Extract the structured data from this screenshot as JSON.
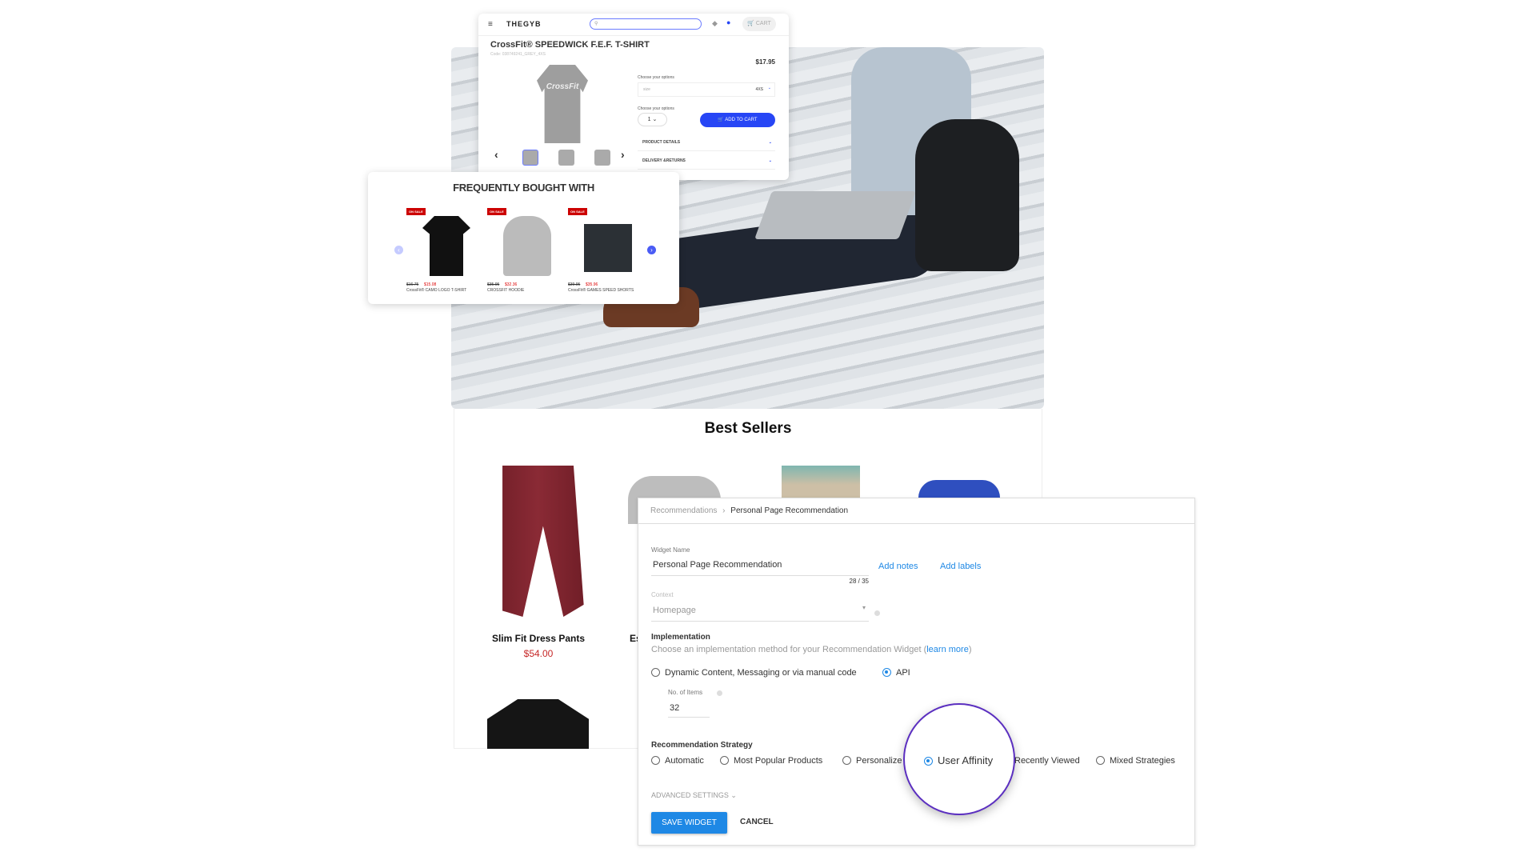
{
  "product_page": {
    "logo": "THEGYB",
    "cart_label": "CART",
    "title": "CrossFit® SPEEDWICK F.E.F. T-SHIRT",
    "code": "Code: 038749241_GREY_4XS",
    "price": "$17.95",
    "shirt_print": "CrossFit",
    "options_label_1": "Choose your options",
    "size_placeholder": "size",
    "size_value": "4XS",
    "options_label_2": "Choose your options",
    "quantity": "1",
    "add_to_cart": "ADD TO CART",
    "product_details": "PRODUCT DETAILS",
    "delivery_returns": "DELIVERY &RETURNS"
  },
  "frequently_bought": {
    "title": "FREQUENTLY BOUGHT WITH",
    "items": [
      {
        "badge": "ON SALE",
        "old_price": "$16.75",
        "price": "$15.08",
        "name": "CrossFit® CAMO LOGO T-SHIRT"
      },
      {
        "badge": "ON SALE",
        "old_price": "$35.95",
        "price": "$32.36",
        "name": "CROSSFIT HOODIE"
      },
      {
        "badge": "ON SALE",
        "old_price": "$39.95",
        "price": "$35.96",
        "name": "CrossFit® GAMES SPEED SHORTS"
      }
    ]
  },
  "best_sellers": {
    "title": "Best Sellers",
    "products": [
      {
        "name": "Slim Fit Dress Pants",
        "price": "$54.00"
      },
      {
        "name": "Es"
      }
    ]
  },
  "widget": {
    "breadcrumb": [
      "Recommendations",
      "Personal Page Recommendation"
    ],
    "widget_name_label": "Widget Name",
    "widget_name_value": "Personal Page Recommendation",
    "counter": "28 / 35",
    "add_notes": "Add notes",
    "add_labels": "Add labels",
    "context_label": "Context",
    "context_value": "Homepage",
    "implementation_title": "Implementation",
    "implementation_desc": "Choose an implementation method for your Recommendation Widget (",
    "learn_more": "learn more",
    "close_paren": ")",
    "impl_options": [
      {
        "label": "Dynamic Content, Messaging or via manual code",
        "selected": false
      },
      {
        "label": "API",
        "selected": true
      }
    ],
    "items_label": "No. of Items",
    "items_value": "32",
    "strategy_title": "Recommendation Strategy",
    "strategies": [
      {
        "label": "Automatic",
        "selected": false
      },
      {
        "label": "Most Popular Products",
        "selected": false
      },
      {
        "label": "Personalize",
        "selected": false
      },
      {
        "label": "User Affinity",
        "selected": true
      },
      {
        "label": "Recently Viewed",
        "selected": false
      },
      {
        "label": "Mixed Strategies",
        "selected": false
      }
    ],
    "advanced": "ADVANCED SETTINGS",
    "save": "SAVE WIDGET",
    "cancel": "CANCEL"
  },
  "colors": {
    "accent": "#1e88e5",
    "highlight_ring": "#5b2fc0",
    "sale": "#cc0000",
    "shop_button": "#2746f5"
  }
}
